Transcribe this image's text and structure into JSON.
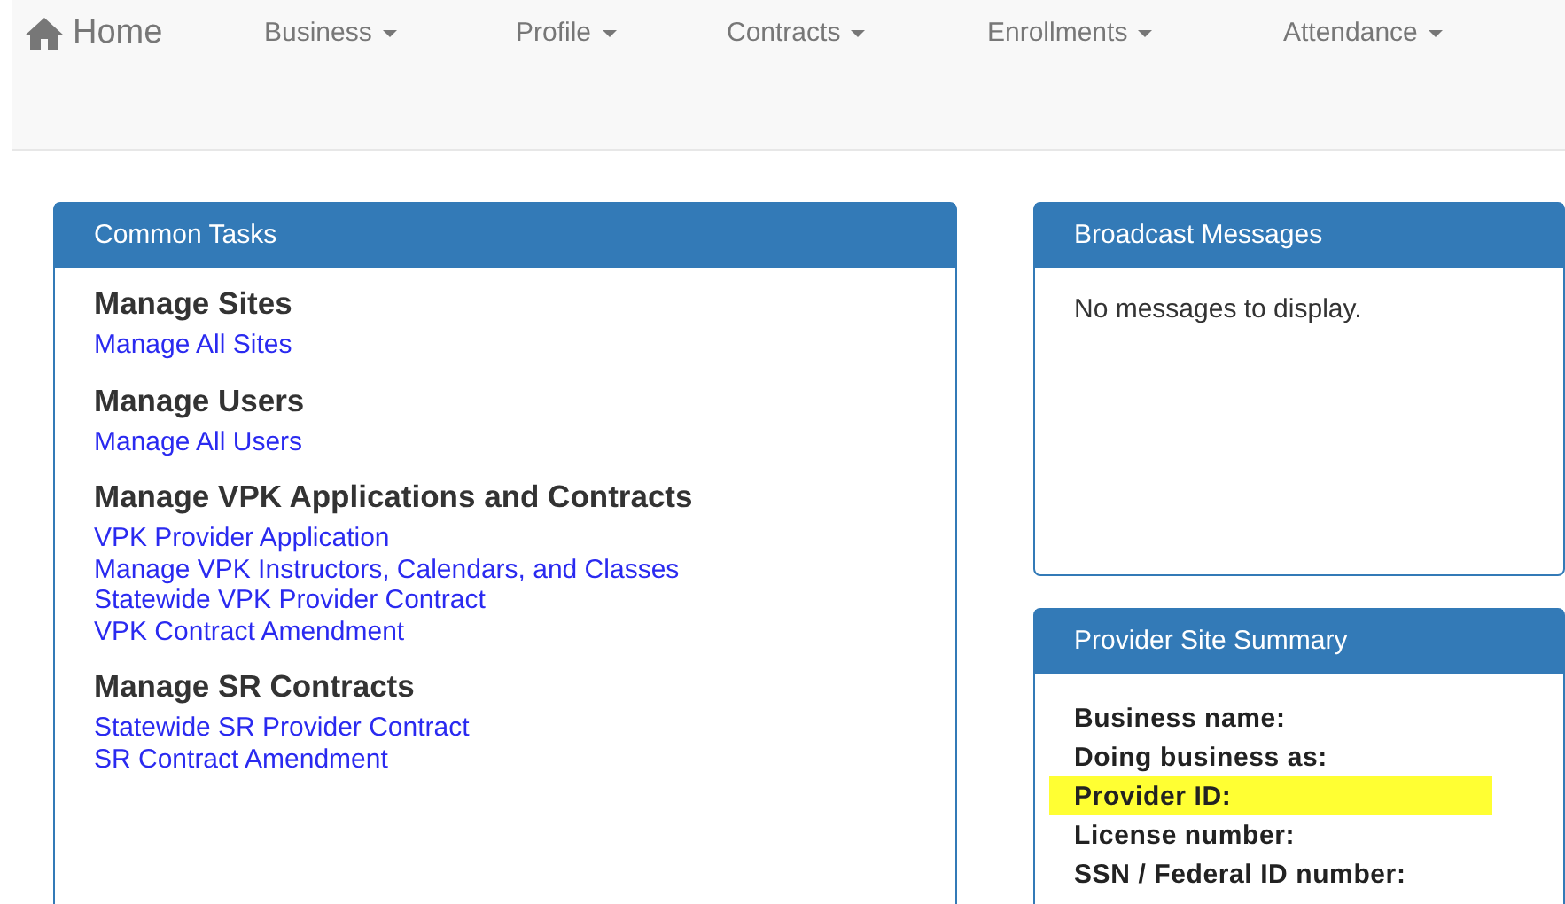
{
  "navbar": {
    "home": "Home",
    "menus": [
      {
        "label": "Business"
      },
      {
        "label": "Profile"
      },
      {
        "label": "Contracts"
      },
      {
        "label": "Enrollments"
      },
      {
        "label": "Attendance"
      }
    ]
  },
  "common_tasks": {
    "title": "Common Tasks",
    "sections": [
      {
        "heading": "Manage Sites",
        "links": [
          "Manage All Sites"
        ]
      },
      {
        "heading": "Manage Users",
        "links": [
          "Manage All Users"
        ]
      },
      {
        "heading": "Manage VPK Applications and Contracts",
        "links": [
          "VPK Provider Application",
          "Manage VPK Instructors, Calendars, and Classes",
          "Statewide VPK Provider Contract",
          "VPK Contract Amendment"
        ]
      },
      {
        "heading": "Manage SR Contracts",
        "links": [
          "Statewide SR Provider Contract",
          "SR Contract Amendment"
        ]
      }
    ]
  },
  "broadcast_messages": {
    "title": "Broadcast Messages",
    "message": "No messages to display."
  },
  "provider_site_summary": {
    "title": "Provider Site Summary",
    "fields": [
      {
        "label": "Business name:",
        "highlighted": false
      },
      {
        "label": "Doing business as:",
        "highlighted": false
      },
      {
        "label": "Provider ID:",
        "highlighted": true
      },
      {
        "label": "License number:",
        "highlighted": false
      },
      {
        "label": "SSN / Federal ID number:",
        "highlighted": false
      }
    ]
  }
}
